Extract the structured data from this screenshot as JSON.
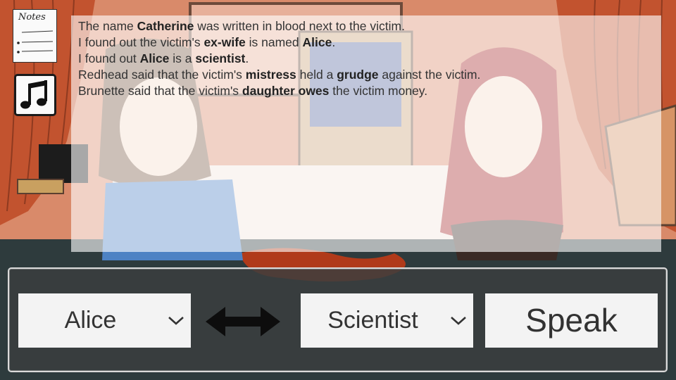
{
  "notes": {
    "title": "Notes",
    "icon": "notes-icon"
  },
  "music": {
    "icon": "music-note-icon"
  },
  "clue_log": [
    {
      "segments": [
        {
          "t": "The name ",
          "b": false
        },
        {
          "t": "Catherine",
          "b": true
        },
        {
          "t": " was written in blood next to the victim.",
          "b": false
        }
      ]
    },
    {
      "segments": [
        {
          "t": "I found out the victim's ",
          "b": false
        },
        {
          "t": "ex-wife",
          "b": true
        },
        {
          "t": " is named ",
          "b": false
        },
        {
          "t": "Alice",
          "b": true
        },
        {
          "t": ".",
          "b": false
        }
      ]
    },
    {
      "segments": [
        {
          "t": "I found out ",
          "b": false
        },
        {
          "t": "Alice",
          "b": true
        },
        {
          "t": " is a ",
          "b": false
        },
        {
          "t": "scientist",
          "b": true
        },
        {
          "t": ".",
          "b": false
        }
      ]
    },
    {
      "segments": [
        {
          "t": "Redhead said that the victim's ",
          "b": false
        },
        {
          "t": "mistress",
          "b": true
        },
        {
          "t": " held a ",
          "b": false
        },
        {
          "t": "grudge",
          "b": true
        },
        {
          "t": " against the victim.",
          "b": false
        }
      ]
    },
    {
      "segments": [
        {
          "t": "Brunette said that the victim's ",
          "b": false
        },
        {
          "t": "daughter owes",
          "b": true
        },
        {
          "t": " the victim money.",
          "b": false
        }
      ]
    }
  ],
  "controls": {
    "left_select": {
      "value": "Alice"
    },
    "swap_icon": "double-arrow-icon",
    "right_select": {
      "value": "Scientist"
    },
    "speak_label": "Speak"
  },
  "colors": {
    "background": "#d98a6a",
    "curtain": "#c2532f",
    "floor": "#2e3b3d",
    "panel": "#3a3e3e",
    "button_face": "#f3f3f3",
    "brunette_top": "#4d82c4",
    "redhead_hair": "#a6292a",
    "blood": "#b03a1a"
  }
}
